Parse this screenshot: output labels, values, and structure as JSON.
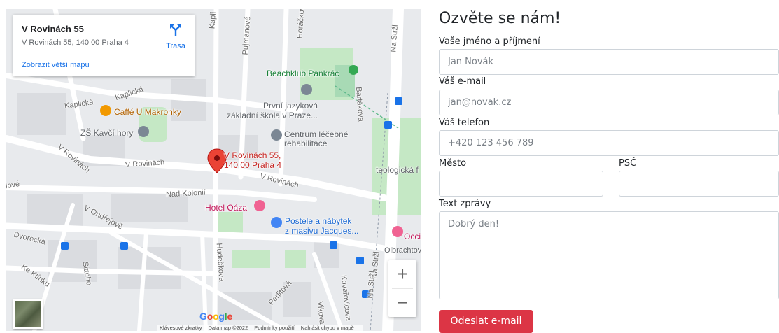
{
  "map": {
    "info_card": {
      "title": "V Rovinách 55",
      "address": "V Rovinách 55, 140 00 Praha 4",
      "route_label": "Trasa",
      "larger_map_link": "Zobrazit větší mapu"
    },
    "marker_label_line1": "V Rovinách 55,",
    "marker_label_line2": "140 00 Praha 4",
    "pois": {
      "beachklub": "Beachklub Pankrác",
      "skola_line1": "První jazyková",
      "skola_line2": "základní škola v Praze...",
      "cafe": "Caffé U Makronky",
      "zs": "ZŠ Kavčí hory",
      "centrum_line1": "Centrum léčebné",
      "centrum_line2": "rehabilitace",
      "hotel": "Hotel Oáza",
      "postele_line1": "Postele a nábytek",
      "postele_line2": "z masivu Jacques...",
      "teologicka": "teologická f",
      "occi": "Occi",
      "olbrachtov": "Olbrachtov"
    },
    "streets": {
      "kaplicka1": "Kaplická",
      "kaplicka2": "Kaplická",
      "rovinach1": "V Rovinách",
      "rovinach2": "V Rovinách",
      "rovinach3": "V Rovinách",
      "nad_kolonii": "Nad Kolonií",
      "ondrejove": "V Ondřejově",
      "dvorecka": "Dvorecká",
      "ke_klinku": "Ke Klínku",
      "sitteho": "Sitteho",
      "hudeckova": "Hudečkova",
      "perlitova": "Perlitová",
      "vikova": "Vikova",
      "kovarovicova": "Kovařovicova",
      "na_strzi1": "Na Strži",
      "na_strzi2": "Na Strži",
      "na_strzi3": "Na Strži",
      "bartakova": "Bartákova",
      "pujmanove": "Pujmanové",
      "horackova": "Horáčkova",
      "kapli": "Kapli",
      "jove": "Jové"
    },
    "google_logo": [
      "G",
      "o",
      "o",
      "g",
      "l",
      "e"
    ],
    "attribution": {
      "shortcuts": "Klávesové zkratky",
      "data": "Data map ©2022",
      "terms": "Podmínky použití",
      "report": "Nahlásit chybu v mapě"
    },
    "zoom_in": "+",
    "zoom_out": "−"
  },
  "form": {
    "title": "Ozvěte se nám!",
    "name_label": "Vaše jméno a příjmení",
    "name_placeholder": "Jan Novák",
    "email_label": "Váš e-mail",
    "email_placeholder": "jan@novak.cz",
    "phone_label": "Váš telefon",
    "phone_placeholder": "+420 123 456 789",
    "city_label": "Město",
    "zip_label": "PSČ",
    "message_label": "Text zprávy",
    "message_placeholder": "Dobrý den!",
    "submit_label": "Odeslat e-mail"
  },
  "colors": {
    "accent_red": "#dc3545",
    "google_blue": "#4285f4",
    "google_red": "#ea4335",
    "google_yellow": "#fbbc05",
    "google_green": "#34a853"
  }
}
